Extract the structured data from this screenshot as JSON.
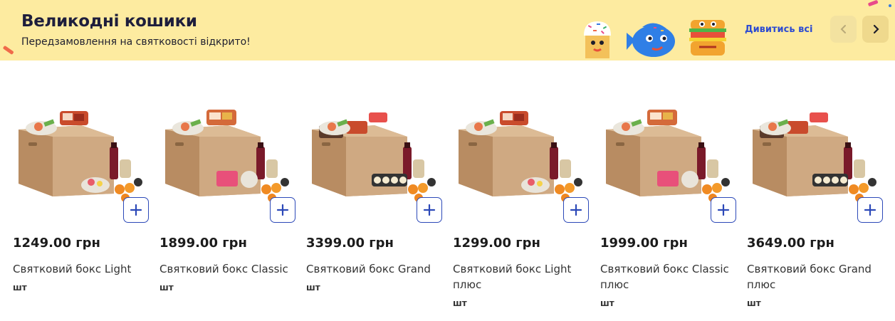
{
  "banner": {
    "title": "Великодні кошики",
    "subtitle": "Передзамовлення на святковості відкрито!",
    "see_all_label": "Дивитись всі",
    "bg_color": "#fdeba0",
    "mascots": [
      "easter-cake-mascot-icon",
      "fish-mascot-icon",
      "sandwich-mascot-icon"
    ]
  },
  "navigation": {
    "prev_icon": "chevron-left-icon",
    "next_icon": "chevron-right-icon"
  },
  "products": [
    {
      "price": "1249.00 грн",
      "name": "Святковий бокс Light",
      "unit": "шт",
      "variant": "light"
    },
    {
      "price": "1899.00 грн",
      "name": "Святковий бокс Classic",
      "unit": "шт",
      "variant": "classic"
    },
    {
      "price": "3399.00 грн",
      "name": "Святковий бокс Grand",
      "unit": "шт",
      "variant": "grand"
    },
    {
      "price": "1299.00 грн",
      "name": "Святковий бокс Light плюс",
      "unit": "шт",
      "variant": "light"
    },
    {
      "price": "1999.00 грн",
      "name": "Святковий бокс Classic плюс",
      "unit": "шт",
      "variant": "classic"
    },
    {
      "price": "3649.00 грн",
      "name": "Святковий бокс Grand плюс",
      "unit": "шт",
      "variant": "grand"
    }
  ]
}
